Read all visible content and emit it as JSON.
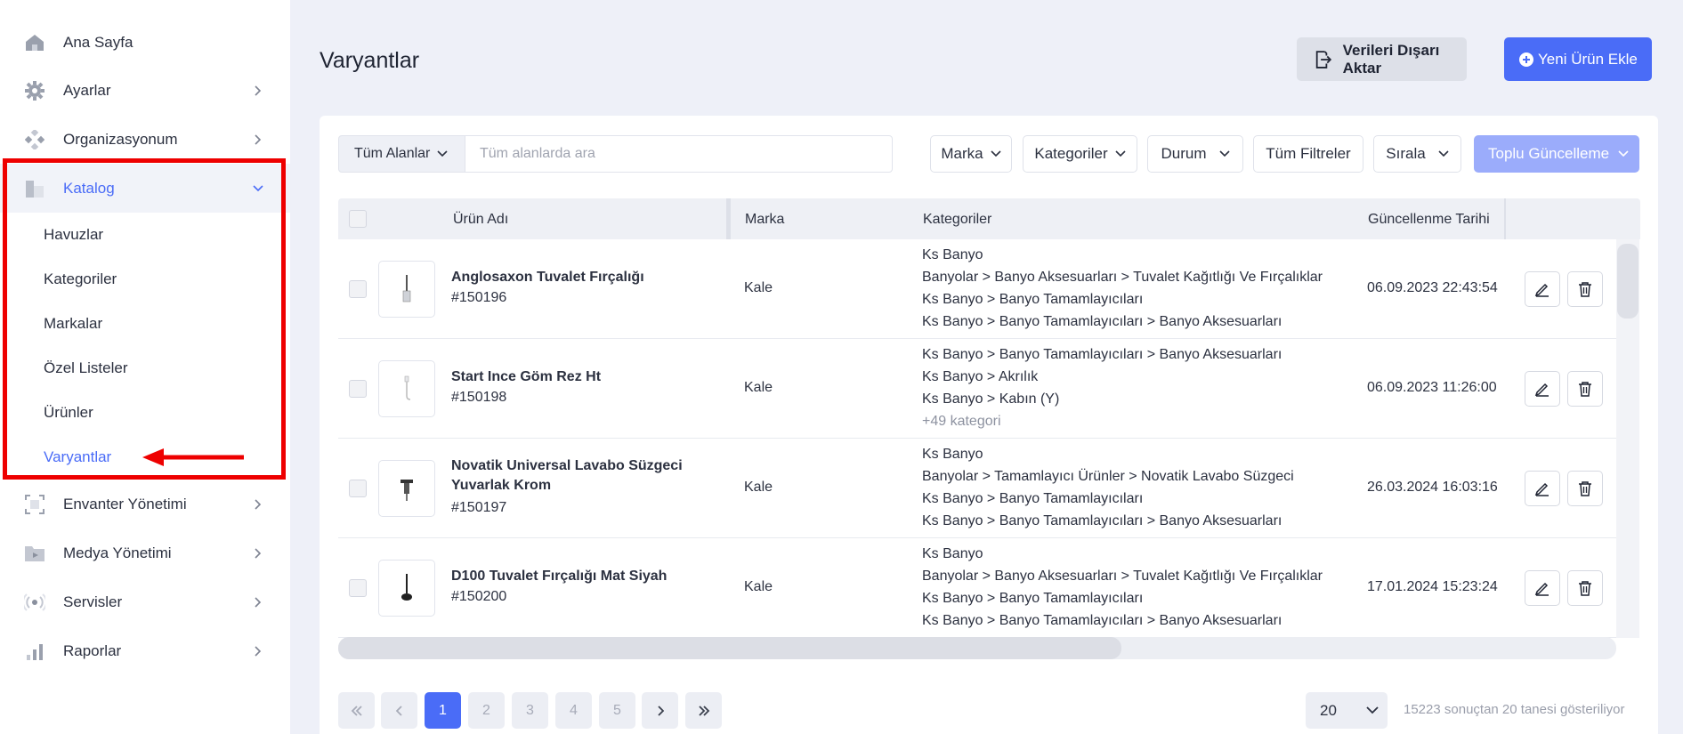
{
  "sidebar": {
    "items": [
      {
        "label": "Ana Sayfa",
        "icon": "home-icon"
      },
      {
        "label": "Ayarlar",
        "icon": "gear-icon"
      },
      {
        "label": "Organizasyonum",
        "icon": "organization-icon"
      },
      {
        "label": "Katalog",
        "icon": "catalog-icon"
      },
      {
        "label": "Envanter Yönetimi",
        "icon": "inventory-icon"
      },
      {
        "label": "Medya Yönetimi",
        "icon": "media-folder-icon"
      },
      {
        "label": "Servisler",
        "icon": "broadcast-icon"
      },
      {
        "label": "Raporlar",
        "icon": "bar-chart-icon"
      }
    ],
    "catalog_sub": [
      "Havuzlar",
      "Kategoriler",
      "Markalar",
      "Özel Listeler",
      "Ürünler",
      "Varyantlar"
    ],
    "active_item": "Katalog",
    "active_sub": "Varyantlar"
  },
  "header": {
    "title": "Varyantlar",
    "export_label": "Verileri Dışarı Aktar",
    "new_label": "Yeni Ürün Ekle"
  },
  "toolbar": {
    "field_select": "Tüm Alanlar",
    "search_placeholder": "Tüm alanlarda ara",
    "filters": [
      "Marka",
      "Kategoriler",
      "Durum",
      "Tüm Filtreler",
      "Sırala"
    ],
    "bulk_label": "Toplu Güncelleme"
  },
  "table": {
    "columns": [
      "Ürün Adı",
      "Marka",
      "Kategoriler",
      "Güncellenme Tarihi"
    ],
    "rows": [
      {
        "name": "Anglosaxon Tuvalet Fırçalığı",
        "id": "#150196",
        "brand": "Kale",
        "categories": [
          "Ks Banyo",
          "Banyolar > Banyo Aksesuarları > Tuvalet Kağıtlığı Ve Fırçalıklar",
          "Ks Banyo > Banyo Tamamlayıcıları",
          "Ks Banyo > Banyo Tamamlayıcıları > Banyo Aksesuarları"
        ],
        "more": "",
        "date": "06.09.2023 22:43:54"
      },
      {
        "name": "Start Ince Göm Rez Ht",
        "id": "#150198",
        "brand": "Kale",
        "categories": [
          "Ks Banyo > Banyo Tamamlayıcıları > Banyo Aksesuarları",
          "Ks Banyo > Akrılık",
          "Ks Banyo > Kabın (Y)"
        ],
        "more": "+49 kategori",
        "date": "06.09.2023 11:26:00"
      },
      {
        "name": "Novatik Universal Lavabo Süzgeci Yuvarlak Krom",
        "id": "#150197",
        "brand": "Kale",
        "categories": [
          "Ks Banyo",
          "Banyolar > Tamamlayıcı Ürünler > Novatik Lavabo Süzgeci",
          "Ks Banyo > Banyo Tamamlayıcıları",
          "Ks Banyo > Banyo Tamamlayıcıları > Banyo Aksesuarları"
        ],
        "more": "",
        "date": "26.03.2024 16:03:16"
      },
      {
        "name": "D100 Tuvalet Fırçalığı Mat Siyah",
        "id": "#150200",
        "brand": "Kale",
        "categories": [
          "Ks Banyo",
          "Banyolar > Banyo Aksesuarları > Tuvalet Kağıtlığı Ve Fırçalıklar",
          "Ks Banyo > Banyo Tamamlayıcıları",
          "Ks Banyo > Banyo Tamamlayıcıları > Banyo Aksesuarları"
        ],
        "more": "",
        "date": "17.01.2024 15:23:24"
      }
    ]
  },
  "pagination": {
    "pages": [
      "1",
      "2",
      "3",
      "4",
      "5"
    ],
    "current_page": "1",
    "page_size": "20",
    "results_text": "15223 sonuçtan 20 tanesi gösteriliyor"
  },
  "colors": {
    "accent": "#4a6cf7",
    "highlight_annotation": "#ee0000"
  }
}
